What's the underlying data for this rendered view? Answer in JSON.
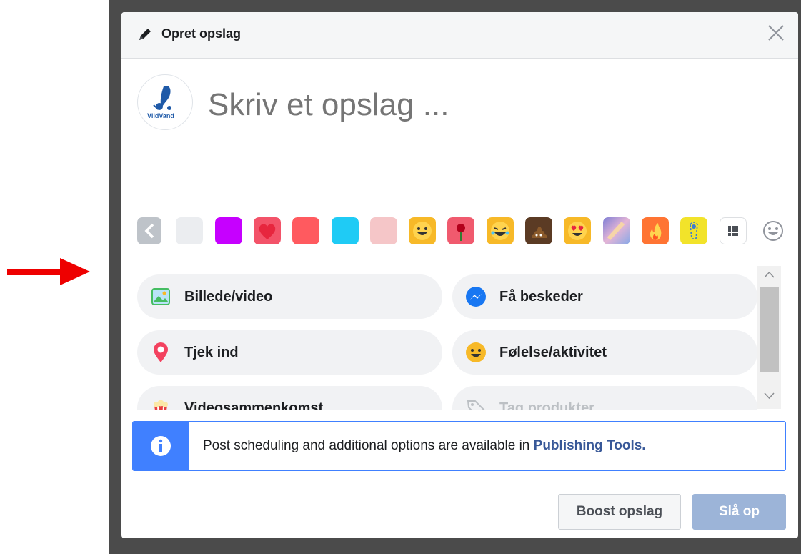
{
  "dialog": {
    "title": "Opret opslag",
    "composer_placeholder": "Skriv et opslag ...",
    "avatar_text": "VildVand"
  },
  "backgrounds": [
    {
      "kind": "arrow-left",
      "color": "#bec3c9"
    },
    {
      "kind": "solid",
      "color": "#ebedf0"
    },
    {
      "kind": "solid",
      "color": "#c600ff"
    },
    {
      "kind": "heart",
      "color": "#f35369"
    },
    {
      "kind": "solid",
      "color": "#ff5a5f"
    },
    {
      "kind": "solid",
      "color": "#1fcbf5"
    },
    {
      "kind": "solid",
      "color": "#f5c6c8"
    },
    {
      "kind": "emoji-smile",
      "color": "#f7b928"
    },
    {
      "kind": "rose",
      "color": "#f05a6e"
    },
    {
      "kind": "emoji-laugh",
      "color": "#f7b928"
    },
    {
      "kind": "poop",
      "color": "#5b3b24"
    },
    {
      "kind": "emoji-hearteyes",
      "color": "#f7b928"
    },
    {
      "kind": "gradient",
      "color": "#b57bd6"
    },
    {
      "kind": "fire",
      "color": "#ff7433"
    },
    {
      "kind": "gift",
      "color": "#f2e32a"
    },
    {
      "kind": "grid",
      "color": "#ffffff"
    }
  ],
  "options": [
    {
      "label": "Billede/video",
      "icon": "photo-icon",
      "disabled": false
    },
    {
      "label": "Få beskeder",
      "icon": "messenger-icon",
      "disabled": false
    },
    {
      "label": "Tjek ind",
      "icon": "location-pin-icon",
      "disabled": false
    },
    {
      "label": "Følelse/aktivitet",
      "icon": "smiley-icon",
      "disabled": false
    },
    {
      "label": "Videosammenkomst",
      "icon": "popcorn-icon",
      "disabled": false
    },
    {
      "label": "Tag produkter",
      "icon": "tag-icon",
      "disabled": true
    }
  ],
  "notice": {
    "text": "Post scheduling and additional options are available in ",
    "link": "Publishing Tools."
  },
  "buttons": {
    "boost": "Boost opslag",
    "post": "Slå op"
  },
  "colors": {
    "arrow": "#ee0000",
    "link": "#385898",
    "info_blue": "#4080ff"
  }
}
